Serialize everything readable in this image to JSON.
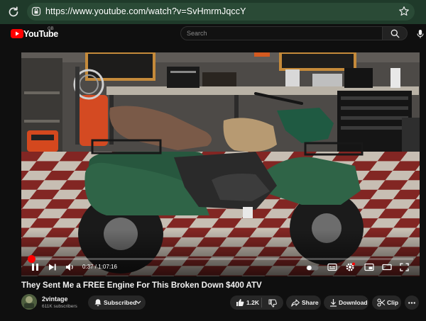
{
  "browser": {
    "url": "https://www.youtube.com/watch?v=SvHmrmJqccY",
    "icons": {
      "reload": "reload-icon",
      "lock": "lock-icon",
      "bookmark": "star-icon"
    }
  },
  "header": {
    "logo_text": "YouTube",
    "region": "GB",
    "search_placeholder": "Search"
  },
  "player": {
    "time_current": "0:37",
    "time_separator": " / ",
    "time_total": "1:07:16",
    "progress": 0.0092
  },
  "video": {
    "title": "They Sent Me a FREE Engine For This Broken Down $400 ATV"
  },
  "channel": {
    "name": "2vintage",
    "subscribers": "611K subscribers"
  },
  "actions": {
    "subscribed_label": "Subscribed",
    "like_count": "1.2K",
    "share_label": "Share",
    "download_label": "Download",
    "clip_label": "Clip"
  },
  "colors": {
    "accent": "#ff0000",
    "chrome": "#1f3a2a",
    "background": "#0f0f0f",
    "pill": "#272727"
  }
}
